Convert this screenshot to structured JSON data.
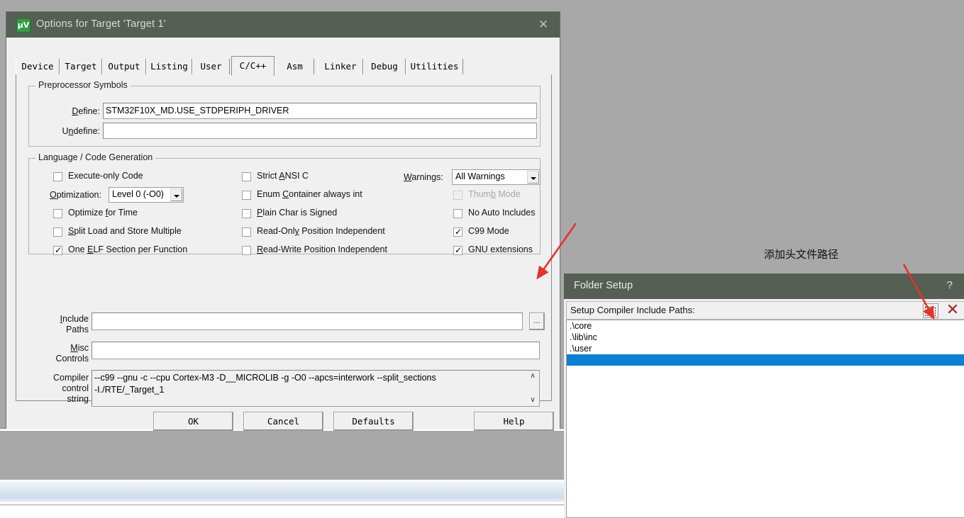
{
  "colors": {
    "titlebar": "#555f53",
    "dialog_face": "#f0f0f0",
    "desktop": "#a8a8a8",
    "selection_blue": "#0a7fd4",
    "annotation_red": "#e8312a",
    "delete_x_red": "#b02020"
  },
  "options_dialog": {
    "title": "Options for Target 'Target 1'",
    "icon": "uvision-icon",
    "close_label": "✕",
    "tabs": [
      {
        "label": "Device",
        "selected": false
      },
      {
        "label": "Target",
        "selected": false
      },
      {
        "label": "Output",
        "selected": false
      },
      {
        "label": "Listing",
        "selected": false
      },
      {
        "label": "User",
        "selected": false
      },
      {
        "label": "C/C++",
        "selected": true
      },
      {
        "label": "Asm",
        "selected": false
      },
      {
        "label": "Linker",
        "selected": false
      },
      {
        "label": "Debug",
        "selected": false
      },
      {
        "label": "Utilities",
        "selected": false
      }
    ],
    "preprocessor": {
      "group_label": "Preprocessor Symbols",
      "define_label": "Define:",
      "define_value": "STM32F10X_MD.USE_STDPERIPH_DRIVER",
      "undefine_label": "Undefine:",
      "undefine_value": ""
    },
    "language": {
      "group_label": "Language / Code Generation",
      "col1": [
        {
          "label": "Execute-only Code",
          "checked": false,
          "enabled": true
        },
        {
          "label": "Optimize for Time",
          "checked": false,
          "enabled": true
        },
        {
          "label": "Split Load and Store Multiple",
          "checked": false,
          "enabled": true
        },
        {
          "label": "One ELF Section per Function",
          "checked": true,
          "enabled": true
        }
      ],
      "optimization_label": "Optimization:",
      "optimization_value": "Level 0 (-O0)",
      "col2": [
        {
          "label": "Strict ANSI C",
          "checked": false,
          "enabled": true
        },
        {
          "label": "Enum Container always int",
          "checked": false,
          "enabled": true
        },
        {
          "label": "Plain Char is Signed",
          "checked": false,
          "enabled": true
        },
        {
          "label": "Read-Only Position Independent",
          "checked": false,
          "enabled": true
        },
        {
          "label": "Read-Write Position Independent",
          "checked": false,
          "enabled": true
        }
      ],
      "warnings_label": "Warnings:",
      "warnings_value": "All Warnings",
      "col3": [
        {
          "label": "Thumb Mode",
          "checked": false,
          "enabled": false
        },
        {
          "label": "No Auto Includes",
          "checked": false,
          "enabled": true
        },
        {
          "label": "C99 Mode",
          "checked": true,
          "enabled": true
        },
        {
          "label": "GNU extensions",
          "checked": true,
          "enabled": true
        }
      ]
    },
    "paths": {
      "include_label_1": "Include",
      "include_label_2": "Paths",
      "include_value": "",
      "browse_label": "...",
      "misc_label_1": "Misc",
      "misc_label_2": "Controls",
      "misc_value": "",
      "compiler_label_1": "Compiler",
      "compiler_label_2": "control",
      "compiler_label_3": "string",
      "compiler_value_line1": "--c99 --gnu -c --cpu Cortex-M3 -D__MICROLIB -g -O0 --apcs=interwork --split_sections",
      "compiler_value_line2": "-I./RTE/_Target_1",
      "scroll_up": "∧",
      "scroll_down": "∨"
    },
    "buttons": {
      "ok": "OK",
      "cancel": "Cancel",
      "defaults": "Defaults",
      "help": "Help"
    }
  },
  "folder_setup": {
    "title": "Folder Setup",
    "help_label": "?",
    "bar_label": "Setup Compiler Include Paths:",
    "new_button": "new-folder-icon",
    "delete_button": "✕",
    "rows": [
      {
        "text": ".\\core",
        "selected": false
      },
      {
        "text": ".\\lib\\inc",
        "selected": false
      },
      {
        "text": ".\\user",
        "selected": false
      },
      {
        "text": "",
        "selected": true
      }
    ]
  },
  "annotations": {
    "add_include_path": "添加头文件路径"
  }
}
